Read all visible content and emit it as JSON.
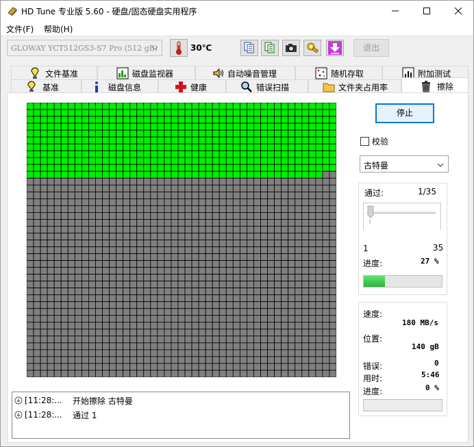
{
  "window": {
    "title": "HD Tune 专业版 5.60 - 硬盘/固态硬盘实用程序",
    "minimize": "minimize",
    "maximize": "maximize",
    "close": "close"
  },
  "menu": {
    "file": "文件(F)",
    "help": "帮助(H)"
  },
  "toolbar": {
    "drive": "GLOWAY YCT512GS3-S7 Pro (512 gB)",
    "temperature": "30℃",
    "exit": "退出"
  },
  "tabs_top": [
    {
      "label": "文件基准",
      "icon": "file-benchmark-icon"
    },
    {
      "label": "磁盘监视器",
      "icon": "disk-monitor-icon"
    },
    {
      "label": "自动噪音管理",
      "icon": "speaker-icon"
    },
    {
      "label": "随机存取",
      "icon": "random-access-icon"
    },
    {
      "label": "附加测试",
      "icon": "extra-tests-icon"
    }
  ],
  "tabs_bottom": [
    {
      "label": "基准",
      "icon": "benchmark-icon"
    },
    {
      "label": "磁盘信息",
      "icon": "info-icon"
    },
    {
      "label": "健康",
      "icon": "health-cross-icon"
    },
    {
      "label": "错误扫描",
      "icon": "magnifier-icon"
    },
    {
      "label": "文件夹占用率",
      "icon": "folder-icon"
    },
    {
      "label": "擦除",
      "icon": "trash-icon",
      "active": true
    }
  ],
  "erase": {
    "stop_label": "停止",
    "verify_label": "校验",
    "verify_checked": false,
    "method": "古特曼",
    "pass_label": "通过:",
    "pass_value": "1/35",
    "slider_min": "1",
    "slider_max": "35",
    "slider_position": 1,
    "progress_label": "进度:",
    "progress_value": "27 %",
    "progress_fraction": 0.27,
    "speed_label": "速度:",
    "speed_value": "180 MB/s",
    "position_label": "位置:",
    "position_value": "140 gB",
    "errors_label": "错误:",
    "errors_value": "0",
    "elapsed_label": "用时:",
    "elapsed_value": "5:46",
    "progress2_label": "进度:",
    "progress2_value": "0 %",
    "progress2_fraction": 0
  },
  "blockmap": {
    "cols": 45,
    "rows": 40,
    "done_blocks": 493,
    "done_color": "#00ee00",
    "pending_color": "#808080",
    "grid_color": "#000000"
  },
  "log": [
    {
      "time": "[11:28:...",
      "message": "开始擦除 古特曼"
    },
    {
      "time": "[11:28:...",
      "message": "通过 1"
    }
  ]
}
